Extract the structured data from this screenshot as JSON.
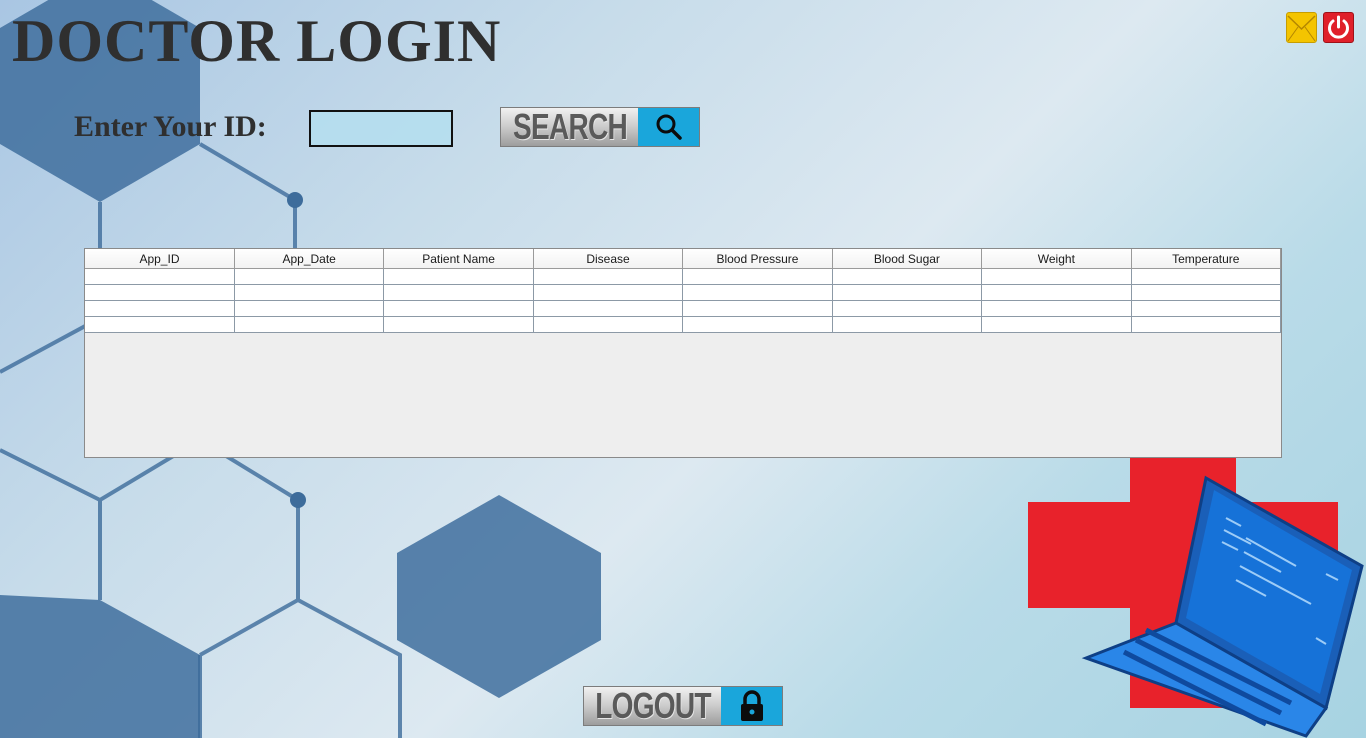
{
  "window": {
    "title": "DOCTOR LOGIN"
  },
  "header_icons": [
    {
      "name": "mail-icon",
      "color": "#f4c400"
    },
    {
      "name": "power-icon",
      "color": "#e0202a"
    }
  ],
  "search": {
    "label": "Enter Your ID:",
    "input_value": "",
    "button_label": "SEARCH",
    "button_icon": "search-icon"
  },
  "table": {
    "columns": [
      "App_ID",
      "App_Date",
      "Patient Name",
      "Disease",
      "Blood Pressure",
      "Blood Sugar",
      "Weight",
      "Temperature"
    ],
    "rows": [
      [
        "",
        "",
        "",
        "",
        "",
        "",
        "",
        ""
      ],
      [
        "",
        "",
        "",
        "",
        "",
        "",
        "",
        ""
      ],
      [
        "",
        "",
        "",
        "",
        "",
        "",
        "",
        ""
      ],
      [
        "",
        "",
        "",
        "",
        "",
        "",
        "",
        ""
      ]
    ]
  },
  "logout": {
    "button_label": "LOGOUT",
    "button_icon": "lock-icon"
  },
  "colors": {
    "accent": "#1aa6db",
    "hexagon": "#3f6e9e",
    "cross": "#e8222b",
    "laptop": "#1e73d8"
  }
}
